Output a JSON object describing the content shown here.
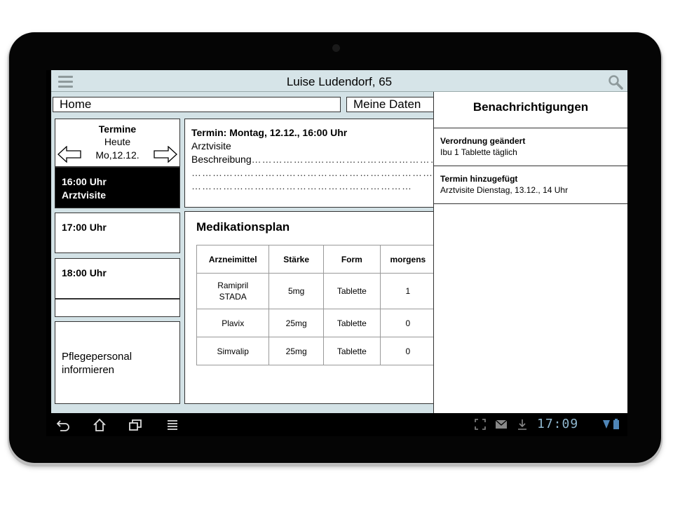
{
  "header": {
    "title": "Luise Ludendorf, 65"
  },
  "nav": {
    "home": "Home",
    "meine_daten": "Meine Daten"
  },
  "termine": {
    "title": "Termine",
    "today": "Heute",
    "date": "Mo,12.12.",
    "slots": [
      {
        "time": "16:00 Uhr",
        "label": "Arztvisite"
      },
      {
        "time": "17:00 Uhr",
        "label": ""
      },
      {
        "time": "18:00 Uhr",
        "label": ""
      }
    ],
    "pflege": "Pflegepersonal informieren"
  },
  "detail": {
    "title": "Termin: Montag, 12.12., 16:00 Uhr",
    "type": "Arztvisite",
    "desc_label": "Beschreibung",
    "dots1": "……………………………………………………",
    "dots2": "……………………………………………………………",
    "dots3": "………………………………………………………"
  },
  "medplan": {
    "title": "Medikationsplan",
    "headers": [
      "Arzneimittel",
      "Stärke",
      "Form",
      "morgens"
    ],
    "rows": [
      [
        "Ramipril\nSTADA",
        "5mg",
        "Tablette",
        "1"
      ],
      [
        "Plavix",
        "25mg",
        "Tablette",
        "0"
      ],
      [
        "Simvalip",
        "25mg",
        "Tablette",
        "0"
      ]
    ]
  },
  "notifications": {
    "title": "Benachrichtigungen",
    "items": [
      {
        "title": "Verordnung geändert",
        "text": "Ibu 1 Tablette täglich"
      },
      {
        "title": "Termin hinzugefügt",
        "text": "Arztvisite Dienstag, 13.12., 14 Uhr"
      }
    ]
  },
  "system": {
    "clock": "17:09"
  },
  "colors": {
    "app_bg": "#d3e2e6",
    "clock": "#8fb7cf",
    "active_slot": "#000000"
  },
  "icons": [
    "menu-icon",
    "search-icon",
    "arrow-left-icon",
    "arrow-right-icon",
    "back-icon",
    "home-icon",
    "recent-apps-icon",
    "menu-lines-icon",
    "screenshot-icon",
    "mail-icon",
    "download-icon",
    "wifi-icon",
    "battery-icon"
  ]
}
